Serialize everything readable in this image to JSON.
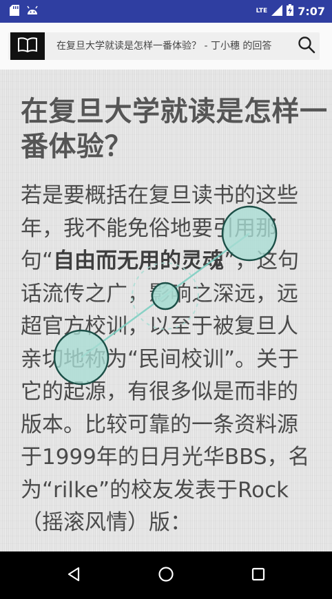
{
  "status_bar": {
    "time": "7:07",
    "network": "LTE",
    "icons": [
      "sd-card-icon",
      "android-icon",
      "signal-icon",
      "battery-charging-icon"
    ]
  },
  "toolbar": {
    "title": "在复旦大学就读是怎样一番体验？ - 丁小穗 的回答",
    "left_icon": "book-icon",
    "right_icon": "search-icon"
  },
  "article": {
    "title": "在复旦大学就读是怎样一番体验？",
    "body_before": "若是要概括在复旦读书的这些年，我不能免俗地要引用那句“",
    "body_bold": "自由而无用的灵魂",
    "body_after": "”，这句话流传之广，影响之深远，远超官方校训，以至于被复旦人亲切地称为“民间校训”。关于它的起源，有很多似是而非的版本。比较可靠的一条资料源于1999年的日月光华BBS，名为“rilke”的校友发表于Rock（摇滚风情）版："
  },
  "nav_bar": {
    "icons": [
      "back-icon",
      "home-icon",
      "recents-icon"
    ]
  },
  "colors": {
    "status_bar": "#2f3ea1",
    "toolbar": "#fafafa",
    "text": "#4a4a4a",
    "touch_fill": "#a8ddd3",
    "touch_stroke": "#1c4f47",
    "nav_bar": "#000000"
  }
}
